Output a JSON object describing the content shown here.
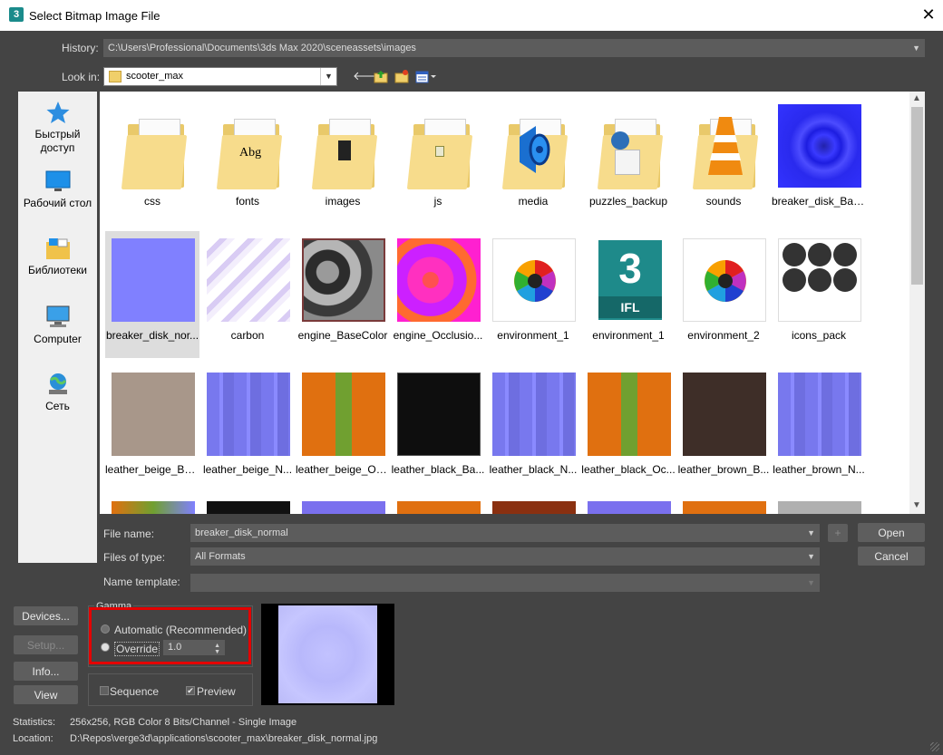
{
  "window": {
    "title": "Select Bitmap Image File",
    "app_icon": "3",
    "close": "✕"
  },
  "history": {
    "label": "History:",
    "value": "C:\\Users\\Professional\\Documents\\3ds Max 2020\\sceneassets\\images"
  },
  "look_in": {
    "label": "Look in:",
    "value": "scooter_max"
  },
  "toolbar_icons": [
    "back-arrow-icon",
    "up-folder-icon",
    "new-folder-icon",
    "view-menu-icon"
  ],
  "places": [
    {
      "label": "Быстрый доступ",
      "icon": "star-icon"
    },
    {
      "label": "Рабочий стол",
      "icon": "desktop-icon"
    },
    {
      "label": "Библиотеки",
      "icon": "libraries-icon"
    },
    {
      "label": "Computer",
      "icon": "computer-icon"
    },
    {
      "label": "Сеть",
      "icon": "network-icon"
    }
  ],
  "files": [
    {
      "name": "css",
      "kind": "folder"
    },
    {
      "name": "fonts",
      "kind": "folder"
    },
    {
      "name": "images",
      "kind": "folder"
    },
    {
      "name": "js",
      "kind": "folder"
    },
    {
      "name": "media",
      "kind": "folder"
    },
    {
      "name": "puzzles_backup",
      "kind": "folder"
    },
    {
      "name": "sounds",
      "kind": "folder"
    },
    {
      "name": "breaker_disk_Bas...",
      "kind": "image"
    },
    {
      "name": "breaker_disk_nor...",
      "kind": "image",
      "selected": true
    },
    {
      "name": "carbon",
      "kind": "image"
    },
    {
      "name": "engine_BaseColor",
      "kind": "image"
    },
    {
      "name": "engine_Occlusio...",
      "kind": "image"
    },
    {
      "name": "environment_1",
      "kind": "image"
    },
    {
      "name": "environment_1",
      "kind": "ifl"
    },
    {
      "name": "environment_2",
      "kind": "image"
    },
    {
      "name": "icons_pack",
      "kind": "image"
    },
    {
      "name": "leather_beige_Ba...",
      "kind": "image"
    },
    {
      "name": "leather_beige_N...",
      "kind": "image"
    },
    {
      "name": "leather_beige_Oc...",
      "kind": "image"
    },
    {
      "name": "leather_black_Ba...",
      "kind": "image"
    },
    {
      "name": "leather_black_N...",
      "kind": "image"
    },
    {
      "name": "leather_black_Oc...",
      "kind": "image"
    },
    {
      "name": "leather_brown_B...",
      "kind": "image"
    },
    {
      "name": "leather_brown_N...",
      "kind": "image"
    }
  ],
  "ifl_text": {
    "digit": "3",
    "ext": "IFL"
  },
  "form": {
    "file_name_label": "File name:",
    "file_name_value": "breaker_disk_normal",
    "files_of_type_label": "Files of type:",
    "files_of_type_value": "All Formats",
    "name_template_label": "Name template:",
    "plus": "+",
    "open": "Open",
    "cancel": "Cancel"
  },
  "side_buttons": {
    "devices": "Devices...",
    "setup": "Setup...",
    "info": "Info...",
    "view": "View"
  },
  "gamma": {
    "title": "Gamma",
    "automatic": "Automatic (Recommended)",
    "override": "Override",
    "override_value": "1.0"
  },
  "options": {
    "sequence": "Sequence",
    "preview": "Preview",
    "preview_checked": "✔"
  },
  "info": {
    "statistics_label": "Statistics:",
    "statistics_value": "256x256, RGB Color 8 Bits/Channel - Single Image",
    "location_label": "Location:",
    "location_value": "D:\\Repos\\verge3d\\applications\\scooter_max\\breaker_disk_normal.jpg"
  },
  "colors": {
    "dialog_bg": "#444444",
    "normal_map": "#8080ff",
    "selection": "#dddddd",
    "highlight": "#e40000"
  }
}
